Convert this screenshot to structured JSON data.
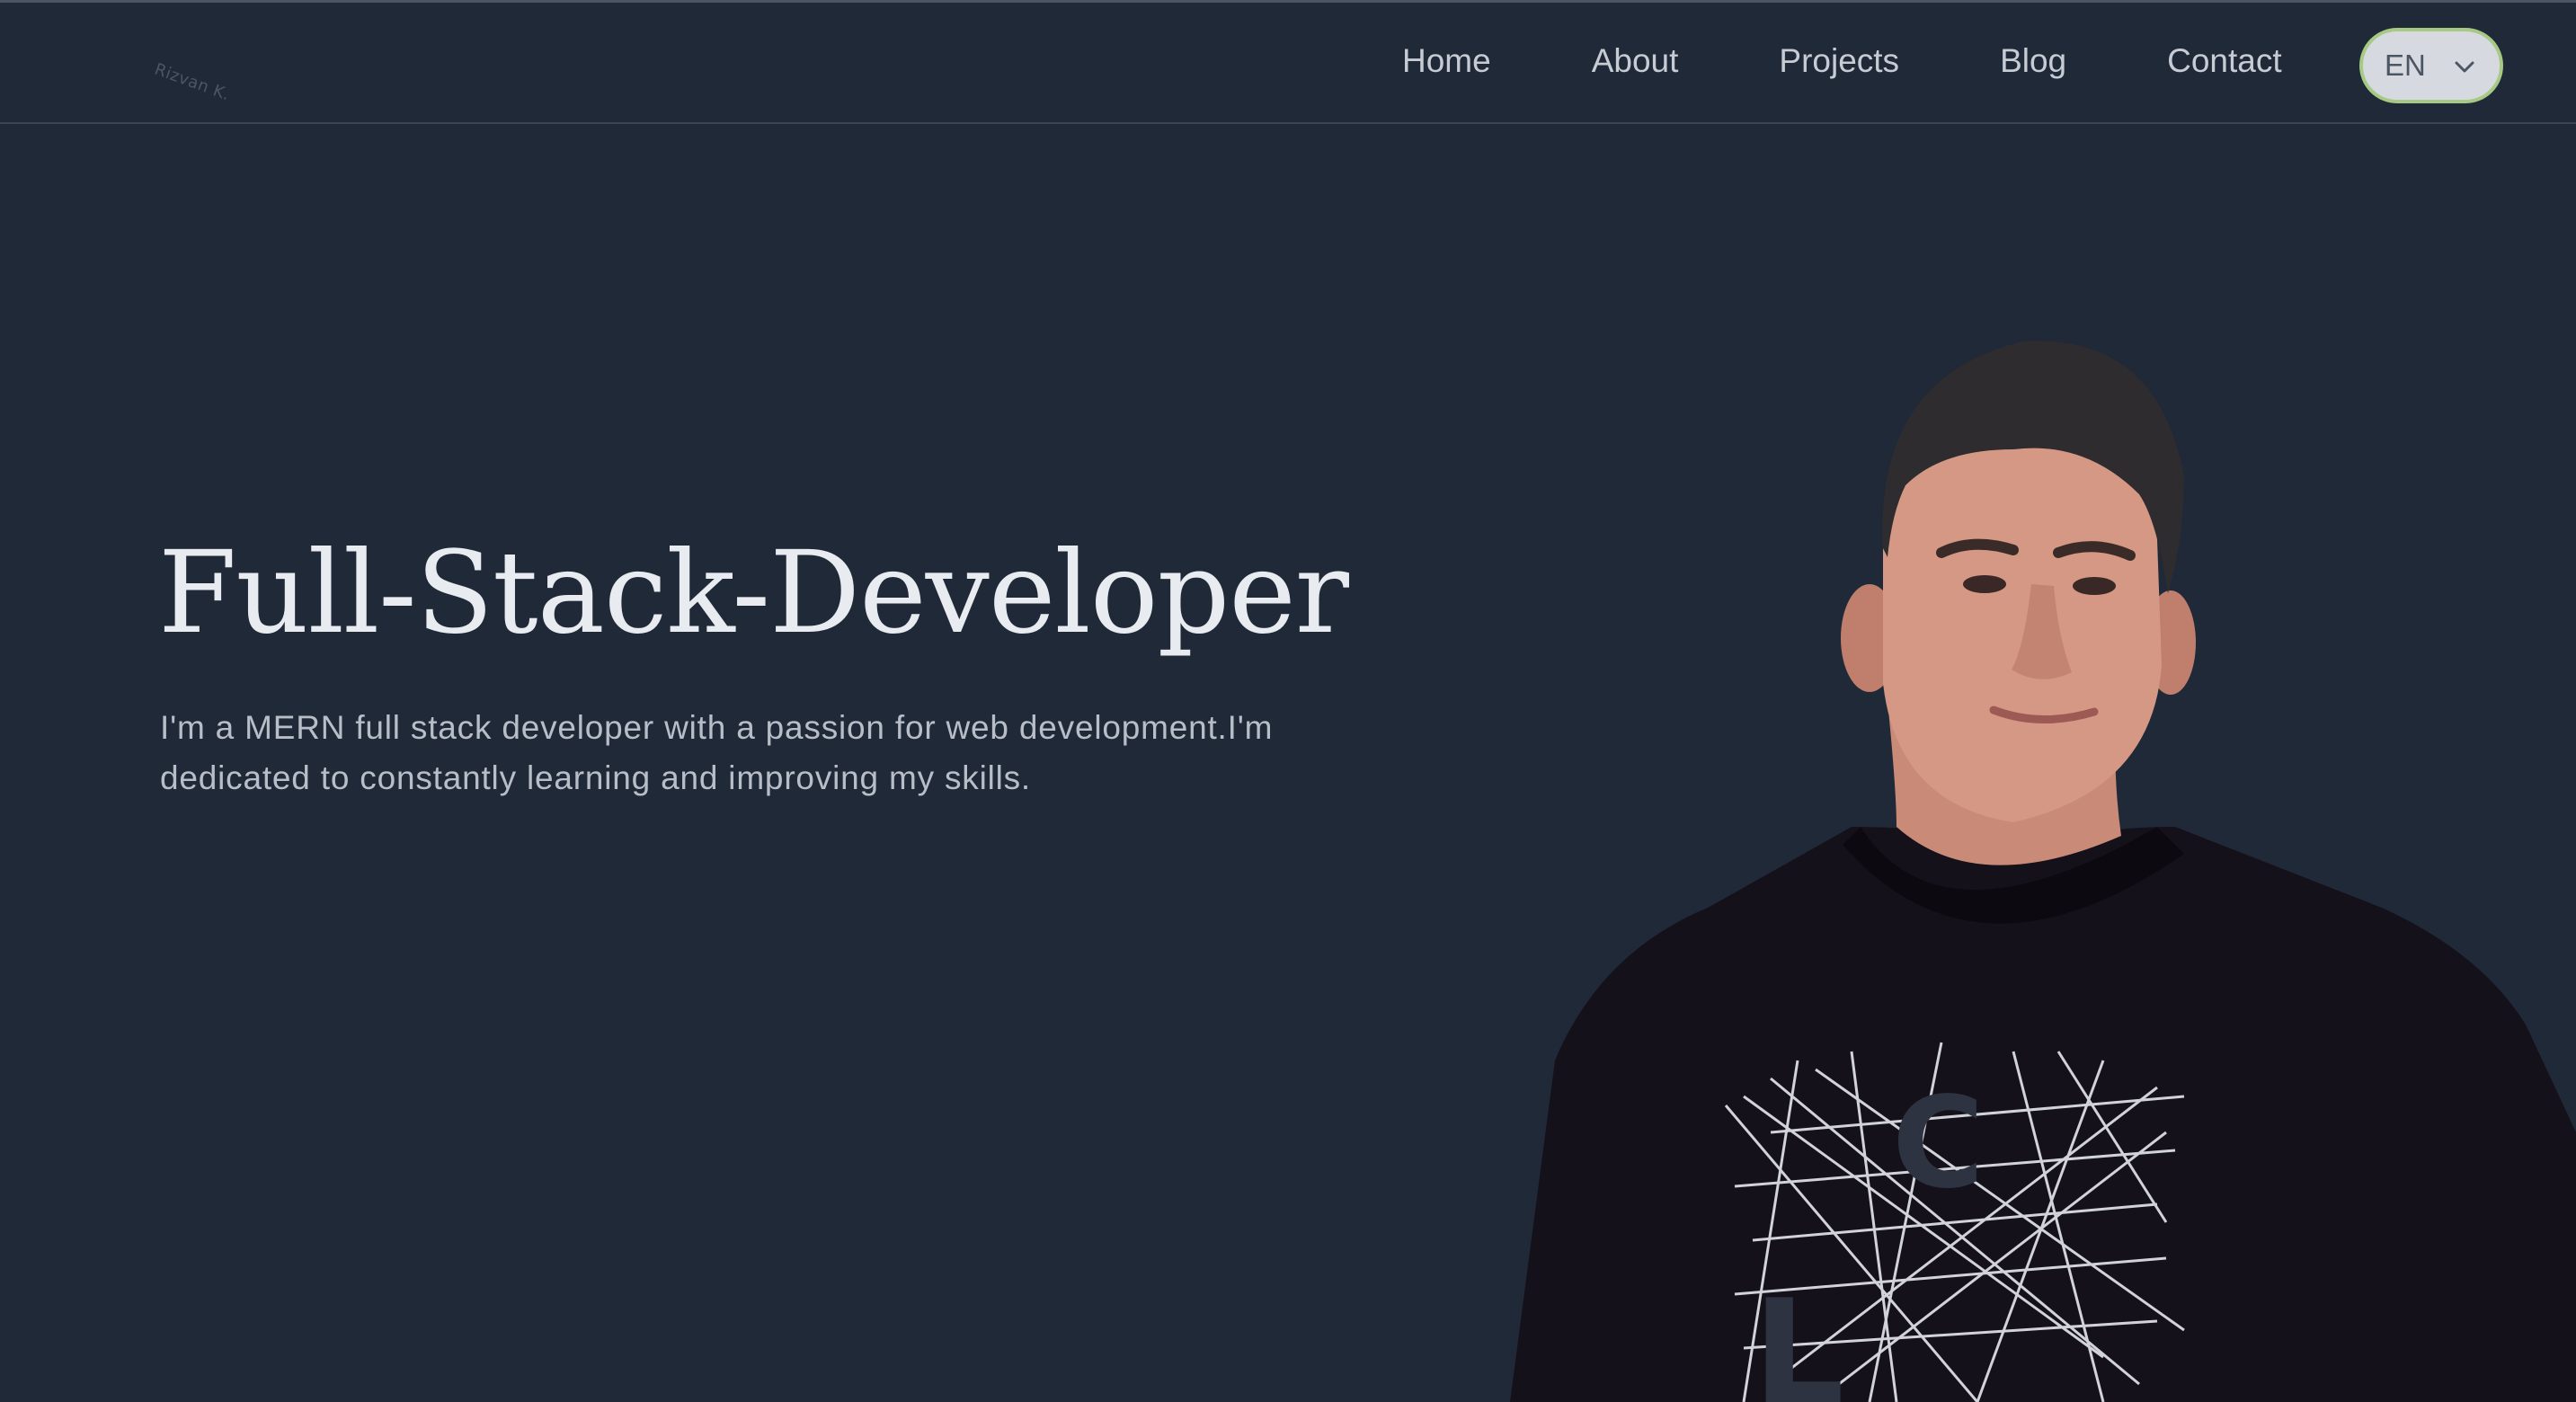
{
  "header": {
    "logo_text": "Rizvan K.",
    "nav": [
      {
        "label": "Home"
      },
      {
        "label": "About"
      },
      {
        "label": "Projects"
      },
      {
        "label": "Blog"
      },
      {
        "label": "Contact"
      }
    ],
    "language": {
      "selected": "EN",
      "icon": "chevron-down-icon"
    }
  },
  "hero": {
    "title": "Full-Stack-Developer",
    "description": "I'm a MERN full stack developer with a passion for web development.I'm dedicated to constantly learning and improving my skills.",
    "portrait_label": "portrait-photo",
    "shirt_letters": [
      "C",
      "L"
    ]
  },
  "colors": {
    "background": "#202938",
    "nav_text": "#c7ccd4",
    "title": "#e8ebef",
    "body_text": "#b8bec8",
    "lang_bg": "#d6dae0",
    "lang_border": "#a6c984"
  }
}
